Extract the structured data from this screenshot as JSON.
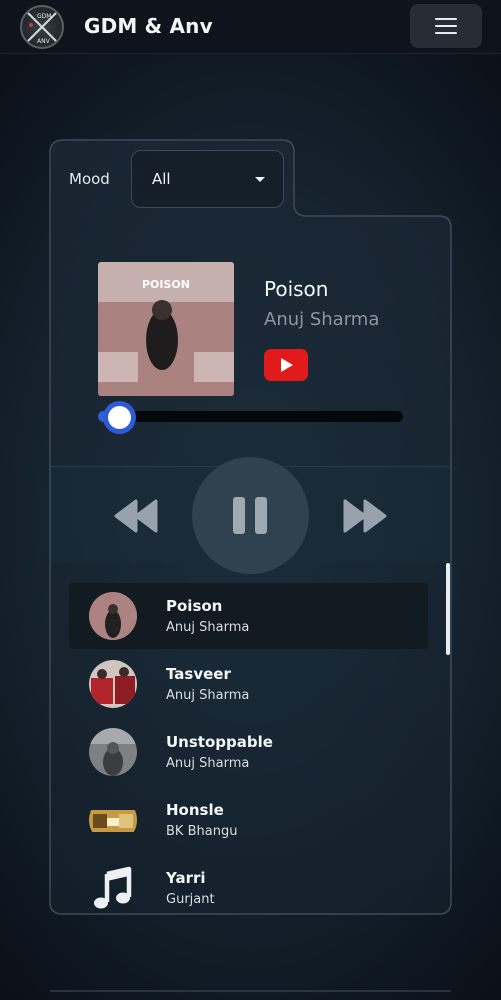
{
  "app": {
    "title": "GDM & Anv",
    "logo_text_top": "GDM",
    "logo_text_bottom": "ANV",
    "menu_icon": "hamburger-icon"
  },
  "mood": {
    "label": "Mood",
    "selected": "All"
  },
  "now_playing": {
    "title": "Poison",
    "artist": "Anuj Sharma",
    "album_art_text": "POISON",
    "youtube_icon": "youtube-play-icon",
    "progress": 0.07
  },
  "controls": {
    "rewind_icon": "rewind-icon",
    "pause_icon": "pause-icon",
    "forward_icon": "fast-forward-icon"
  },
  "playlist": [
    {
      "title": "Poison",
      "artist": "Anuj Sharma",
      "active": true
    },
    {
      "title": "Tasveer",
      "artist": "Anuj Sharma",
      "active": false
    },
    {
      "title": "Unstoppable",
      "artist": "Anuj Sharma",
      "active": false
    },
    {
      "title": "Honsle",
      "artist": "BK Bhangu",
      "active": false
    },
    {
      "title": "Yarri",
      "artist": "Gurjant",
      "active": false
    }
  ],
  "colors": {
    "accent": "#2f5fd8",
    "youtube": "#e11b1b",
    "background": "#0b121a"
  }
}
